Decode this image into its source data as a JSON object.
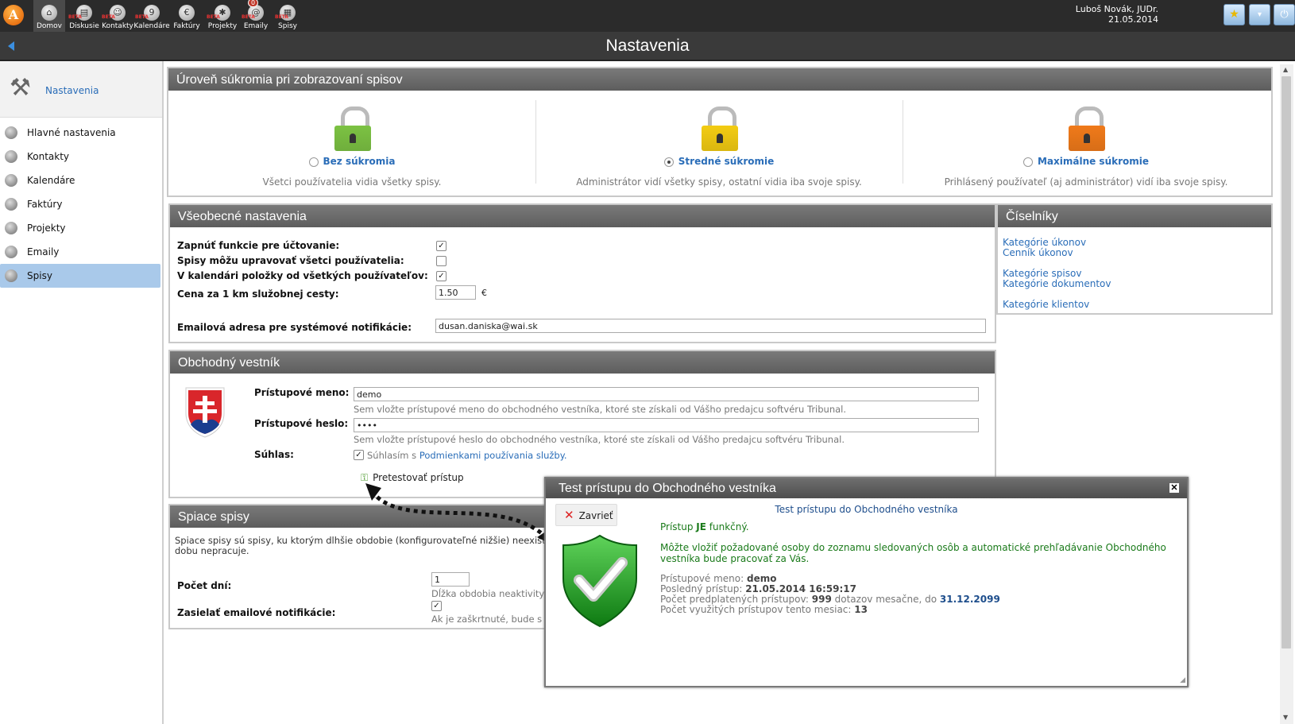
{
  "topnav": {
    "items": [
      {
        "label": "Domov",
        "icon": "home-icon",
        "glyph": "⌂",
        "beta": ""
      },
      {
        "label": "Diskusie",
        "icon": "discussion-icon",
        "glyph": "▤",
        "beta": "BETA"
      },
      {
        "label": "Kontakty",
        "icon": "contacts-icon",
        "glyph": "☺",
        "beta": "BETA"
      },
      {
        "label": "Kalendáre",
        "icon": "calendar-icon",
        "glyph": "9",
        "beta": "BETA"
      },
      {
        "label": "Faktúry",
        "icon": "invoice-icon",
        "glyph": "€",
        "beta": ""
      },
      {
        "label": "Projekty",
        "icon": "projects-icon",
        "glyph": "✱",
        "beta": "BETA"
      },
      {
        "label": "Emaily",
        "icon": "email-icon",
        "glyph": "@",
        "beta": "BETA",
        "badge": "0"
      },
      {
        "label": "Spisy",
        "icon": "files-icon",
        "glyph": "▦",
        "beta": "BETA"
      }
    ]
  },
  "user": {
    "name": "Luboš Novák, JUDr.",
    "date": "21.05.2014"
  },
  "page": {
    "title": "Nastavenia"
  },
  "sidebar": {
    "header": "Nastavenia",
    "items": [
      {
        "label": "Hlavné nastavenia",
        "icon": "settings-icon"
      },
      {
        "label": "Kontakty",
        "icon": "contacts-icon"
      },
      {
        "label": "Kalendáre",
        "icon": "calendar-icon"
      },
      {
        "label": "Faktúry",
        "icon": "invoice-icon"
      },
      {
        "label": "Projekty",
        "icon": "projects-icon"
      },
      {
        "label": "Emaily",
        "icon": "email-icon"
      },
      {
        "label": "Spisy",
        "icon": "files-icon"
      }
    ],
    "active": "Spisy"
  },
  "privacy": {
    "title": "Úroveň súkromia pri zobrazovaní spisov",
    "options": [
      {
        "name": "Bez súkromia",
        "desc": "Všetci používatelia vidia všetky spisy.",
        "color": "#7cc243",
        "selected": false
      },
      {
        "name": "Stredné súkromie",
        "desc": "Administrátor vidí všetky spisy, ostatní vidia iba svoje spisy.",
        "color": "#f3cc12",
        "selected": true
      },
      {
        "name": "Maximálne súkromie",
        "desc": "Prihlásený používateľ (aj administrátor) vidí iba svoje spisy.",
        "color": "#f07a1a",
        "selected": false
      }
    ]
  },
  "general": {
    "title": "Všeobecné nastavenia",
    "billing_label": "Zapnúť funkcie pre účtovanie:",
    "edit_label": "Spisy môžu upravovať všetci používatelia:",
    "calendar_label": "V kalendári položky od všetkých používateľov:",
    "km_label": "Cena za 1 km služobnej cesty:",
    "km_value": "1.50",
    "km_unit": "€",
    "email_label": "Emailová adresa pre systémové notifikácie:",
    "email_value": "dusan.daniska@wai.sk"
  },
  "ciselniky": {
    "title": "Číselníky",
    "links": [
      "Kategórie úkonov",
      "Cenník úkonov",
      "Kategórie spisov",
      "Kategórie dokumentov",
      "Kategórie klientov"
    ]
  },
  "vestnik": {
    "title": "Obchodný vestník",
    "login_label": "Prístupové meno:",
    "login_value": "demo",
    "login_hint": "Sem vložte prístupové meno do obchodného vestníka, ktoré ste získali od Vášho predajcu softvéru Tribunal.",
    "pass_label": "Prístupové heslo:",
    "pass_value": "••••",
    "pass_hint": "Sem vložte prístupové heslo do obchodného vestníka, ktoré ste získali od Vášho predajcu softvéru Tribunal.",
    "consent_label": "Súhlas:",
    "consent_text": "Súhlasím s ",
    "consent_link": "Podmienkami používania služby.",
    "test_label": "Pretestovať prístup"
  },
  "sleeping": {
    "title": "Spiace spisy",
    "desc1": "Spiace spisy sú spisy, ku ktorým dlhšie obdobie (konfigurovateľné nižšie) neexist",
    "desc2": "dobu nepracuje.",
    "days_label": "Počet dní:",
    "days_value": "1",
    "days_hint": "Dĺžka obdobia neaktivity",
    "notify_label": "Zasielať emailové notifikácie:",
    "notify_hint": "Ak je zaškrtnuté, bude s"
  },
  "dialog": {
    "title": "Test prístupu do Obchodného vestníka",
    "subtitle": "Test prístupu do Obchodného vestníka",
    "close_label": "Zavrieť",
    "status_pre": "Prístup ",
    "status_strong": "JE",
    "status_post": " funkčný.",
    "info": "Môžte vložiť požadované osoby do zoznamu sledovaných osôb a automatické prehľadávanie Obchodného vestníka bude pracovať za Vás.",
    "login_label": "Prístupové meno: ",
    "login_value": "demo",
    "last_label": "Posledný prístup: ",
    "last_value": "21.05.2014 16:59:17",
    "paid_label": "Počet predplatených prístupov: ",
    "paid_value": "999",
    "paid_mid": " dotazov mesačne, do ",
    "paid_date": "31.12.2099",
    "used_label": "Počet využitých prístupov tento mesiac: ",
    "used_value": "13"
  }
}
